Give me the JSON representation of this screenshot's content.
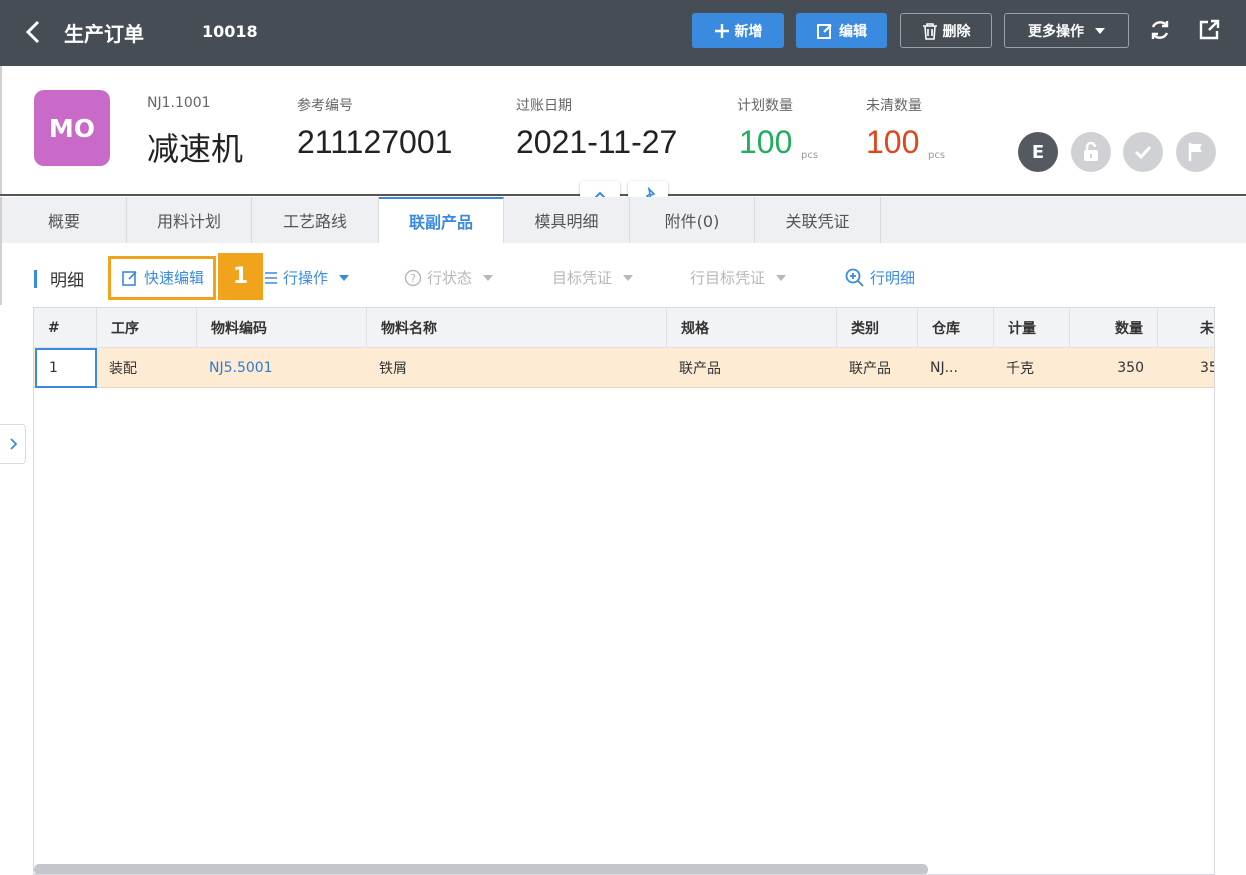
{
  "header_bar": {
    "title": "生产订单",
    "order_no": "10018",
    "buttons": {
      "add": "新增",
      "edit": "编辑",
      "delete": "删除",
      "more": "更多操作"
    }
  },
  "summary": {
    "avatar": "MO",
    "code": "NJ1.1001",
    "name": "减速机",
    "ref_label": "参考编号",
    "ref_value": "211127001",
    "date_label": "过账日期",
    "date_value": "2021-11-27",
    "plan_label": "计划数量",
    "plan_value": "100",
    "plan_unit": "pcs",
    "open_label": "未清数量",
    "open_value": "100",
    "open_unit": "pcs",
    "status_badge": "E",
    "colors": {
      "plan": "#1fae5b",
      "open": "#e0461c",
      "avatar": "#c96ac9"
    }
  },
  "tabs": [
    "概要",
    "用料计划",
    "工艺路线",
    "联副产品",
    "模具明细",
    "附件(0)",
    "关联凭证"
  ],
  "active_tab": "联副产品",
  "toolbar": {
    "section": "明细",
    "quick_edit": "快速编辑",
    "row_ops": "行操作",
    "row_status": "行状态",
    "target_doc": "目标凭证",
    "row_target_doc": "行目标凭证",
    "row_detail": "行明细",
    "callout": "1"
  },
  "table": {
    "columns": [
      "#",
      "工序",
      "物料编码",
      "物料名称",
      "规格",
      "类别",
      "仓库",
      "计量",
      "数量",
      "未"
    ],
    "rows": [
      [
        "1",
        "装配",
        "NJ5.5001",
        "铁屑",
        "联产品",
        "联产品",
        "NJ...",
        "千克",
        "350",
        "35"
      ]
    ]
  }
}
